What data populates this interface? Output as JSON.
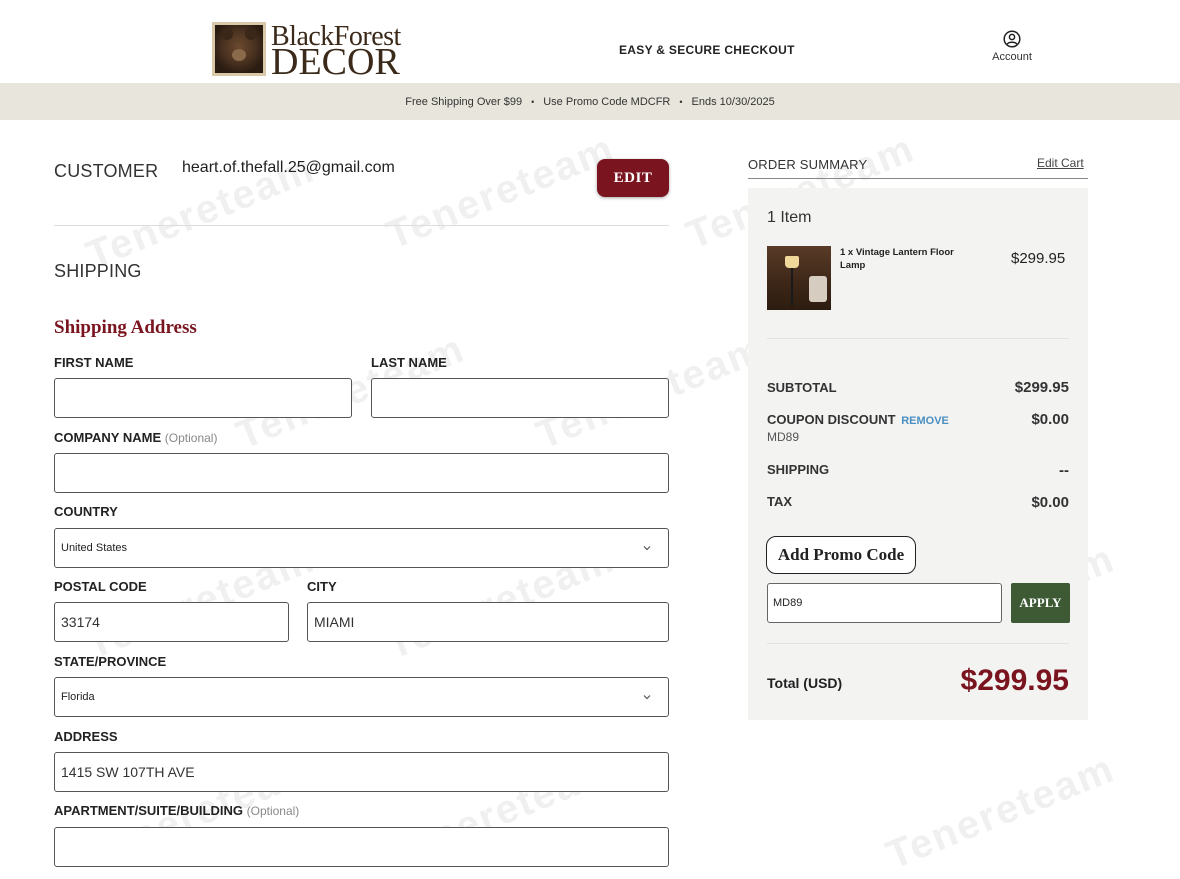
{
  "header": {
    "logo_line1": "BlackForest",
    "logo_line2": "DECOR",
    "checkout_title": "EASY & SECURE CHECKOUT",
    "account_label": "Account"
  },
  "promo_bar": {
    "items": [
      "Free Shipping Over $99",
      "Use Promo Code MDCFR",
      "Ends 10/30/2025"
    ],
    "separator": "•"
  },
  "customer": {
    "heading": "CUSTOMER",
    "email": "heart.of.thefall.25@gmail.com",
    "edit_label": "EDIT"
  },
  "shipping": {
    "heading": "SHIPPING",
    "subheading": "Shipping Address",
    "fields": {
      "first_name": {
        "label": "FIRST NAME",
        "value": ""
      },
      "last_name": {
        "label": "LAST NAME",
        "value": ""
      },
      "company": {
        "label": "COMPANY NAME",
        "optional": "(Optional)",
        "value": ""
      },
      "country": {
        "label": "COUNTRY",
        "value": "United States"
      },
      "postal_code": {
        "label": "POSTAL CODE",
        "value": "33174"
      },
      "city": {
        "label": "CITY",
        "value": "MIAMI"
      },
      "state": {
        "label": "STATE/PROVINCE",
        "value": "Florida"
      },
      "address": {
        "label": "ADDRESS",
        "value": "1415 SW 107TH AVE"
      },
      "apartment": {
        "label": "APARTMENT/SUITE/BUILDING",
        "optional": "(Optional)",
        "value": ""
      }
    }
  },
  "summary": {
    "heading": "ORDER SUMMARY",
    "edit_cart": "Edit Cart",
    "items_count": "1 Item",
    "product": {
      "name": "1 x Vintage Lantern Floor Lamp",
      "price": "$299.95"
    },
    "subtotal_label": "SUBTOTAL",
    "subtotal_value": "$299.95",
    "coupon_label": "COUPON DISCOUNT",
    "coupon_remove": "REMOVE",
    "coupon_code": "MD89",
    "coupon_value": "$0.00",
    "shipping_label": "SHIPPING",
    "shipping_value": "--",
    "tax_label": "TAX",
    "tax_value": "$0.00",
    "add_promo_label": "Add Promo Code",
    "promo_input_value": "MD89",
    "apply_label": "APPLY",
    "total_label": "Total (USD)",
    "total_value": "$299.95"
  },
  "colors": {
    "brand_red": "#7a1520",
    "apply_green": "#3d5a35",
    "promo_bar_bg": "#e8e6dc",
    "summary_bg": "#f3f3f2"
  },
  "watermark": "Tenereteam"
}
